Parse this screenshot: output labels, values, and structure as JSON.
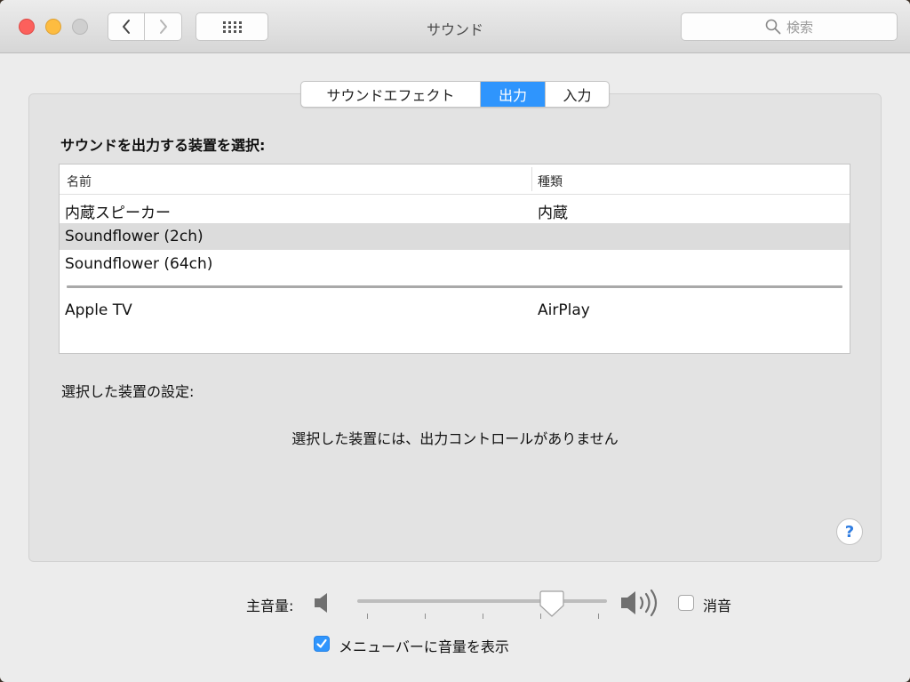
{
  "window": {
    "title": "サウンド",
    "search_placeholder": "検索"
  },
  "tabs": [
    {
      "label": "サウンドエフェクト",
      "selected": false
    },
    {
      "label": "出力",
      "selected": true
    },
    {
      "label": "入力",
      "selected": false
    }
  ],
  "output": {
    "section_title": "サウンドを出力する装置を選択:",
    "columns": {
      "name": "名前",
      "kind": "種類"
    },
    "devices": [
      {
        "name": "内蔵スピーカー",
        "kind": "内蔵",
        "selected": false
      },
      {
        "name": "Soundflower (2ch)",
        "kind": "",
        "selected": true
      },
      {
        "name": "Soundflower (64ch)",
        "kind": "",
        "selected": false
      },
      {
        "name": "Apple TV",
        "kind": "AirPlay",
        "selected": false
      }
    ],
    "settings_label": "選択した装置の設定:",
    "no_controls_message": "選択した装置には、出力コントロールがありません",
    "help_label": "?"
  },
  "volume": {
    "label": "主音量:",
    "level": 0.79,
    "mute_label": "消音",
    "mute_checked": false,
    "show_in_menubar_label": "メニューバーに音量を表示",
    "show_in_menubar_checked": true
  },
  "colors": {
    "accent": "#2f95fd",
    "selected_row": "#dcdcdc",
    "close": "#fc605c",
    "minimize": "#fdbc40"
  }
}
